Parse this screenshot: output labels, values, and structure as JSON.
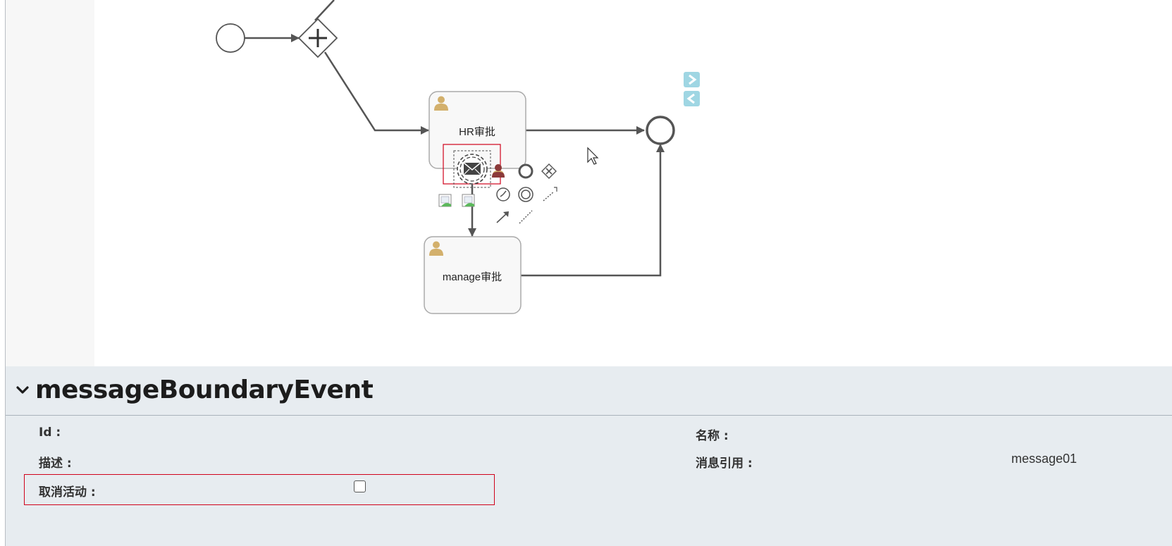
{
  "diagram": {
    "tasks": [
      {
        "id": "hr-task",
        "label": "HR审批"
      },
      {
        "id": "manage-task",
        "label": "manage审批"
      }
    ],
    "colors": {
      "stroke": "#555555",
      "task_fill": "#f8f8f8",
      "user_icon": "#d3b06c",
      "selection": "#d0021b",
      "nav_arrow": "#9fd6e3"
    },
    "icons": [
      "start-event-icon",
      "parallel-gateway-icon",
      "end-event-icon",
      "message-boundary-event-icon",
      "user-task-icon",
      "nav-next-icon",
      "nav-prev-icon",
      "mouse-cursor-icon"
    ]
  },
  "props": {
    "title": "messageBoundaryEvent",
    "id_label": "Id :",
    "name_label": "名称 :",
    "desc_label": "描述 :",
    "msg_ref_label": "消息引用 :",
    "msg_ref_value": "message01",
    "cancel_label": "取消活动 :",
    "cancel_checked": false
  }
}
